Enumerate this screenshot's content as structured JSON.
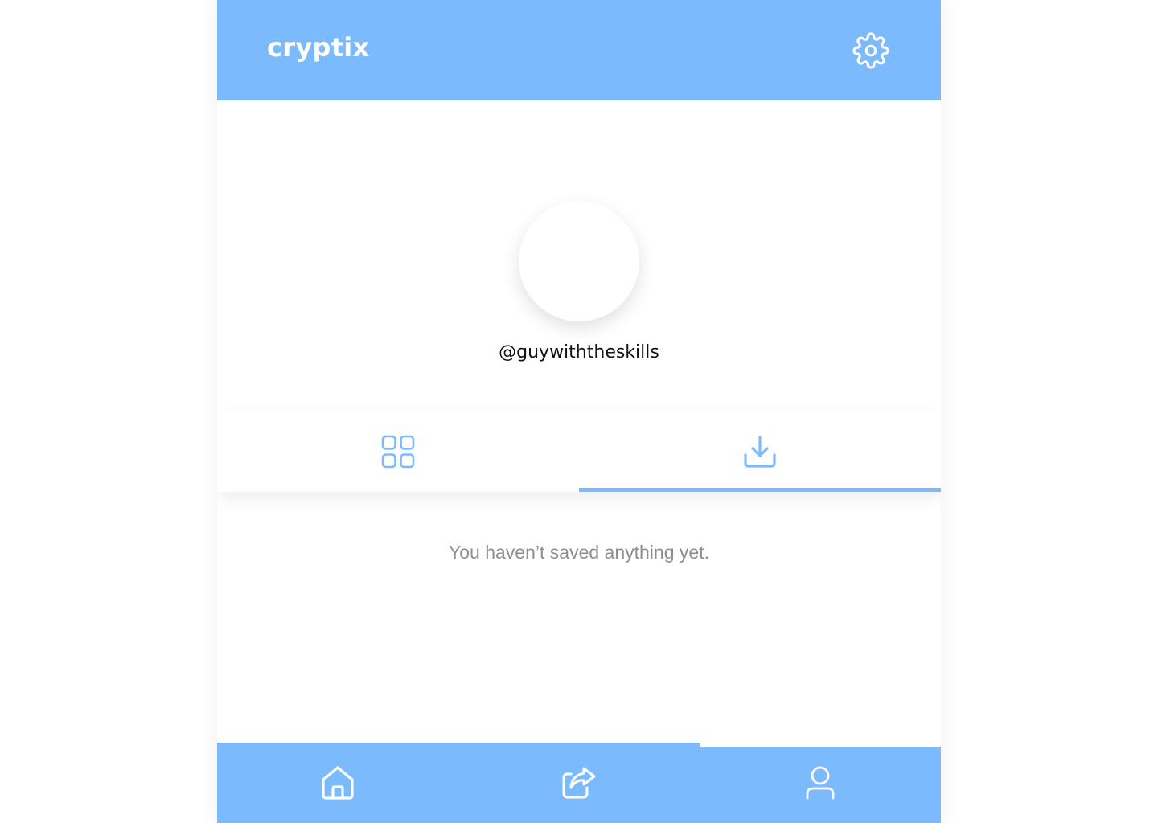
{
  "header": {
    "app_name": "cryptix",
    "settings_icon": "gear-icon"
  },
  "profile": {
    "username": "@guywiththeskills"
  },
  "tabs": [
    {
      "icon": "grid-icon",
      "active": false
    },
    {
      "icon": "download-icon",
      "active": true
    }
  ],
  "saved": {
    "empty_message": "You haven’t saved anything yet."
  },
  "bottom_nav": [
    {
      "icon": "home-icon",
      "active": false
    },
    {
      "icon": "share-icon",
      "active": false
    },
    {
      "icon": "user-icon",
      "active": true
    }
  ],
  "colors": {
    "accent": "#7BBBFD",
    "background": "#FFFFFF",
    "muted_text": "#8E8E8E"
  }
}
